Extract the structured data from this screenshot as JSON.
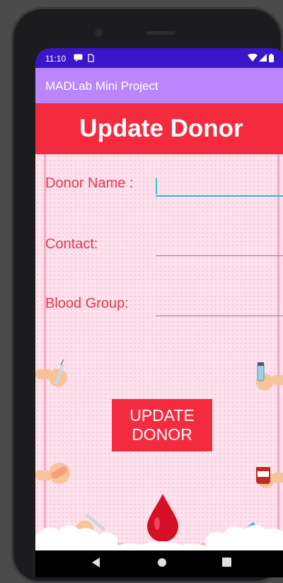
{
  "status_bar": {
    "time": "11:10",
    "icons": [
      "message-icon",
      "sim-icon",
      "wifi-icon",
      "signal-icon",
      "battery-icon"
    ]
  },
  "app_bar": {
    "title": "MADLab Mini Project"
  },
  "banner": {
    "title": "Update Donor"
  },
  "form": {
    "donor_name_label": "Donor Name :",
    "donor_name_value": "",
    "contact_label": "Contact:",
    "contact_value": "",
    "blood_group_label": "Blood Group:",
    "blood_group_value": ""
  },
  "update_button": {
    "line1": "UPDATE",
    "line2": "DONOR"
  },
  "nav_bar": {
    "back": "back-icon",
    "home": "home-icon",
    "recents": "recents-icon"
  },
  "decorations": [
    "syringe-hand-icon",
    "vial-hand-icon",
    "bandage-hand-icon",
    "pill-bottle-hand-icon",
    "thermometer-hand-icon",
    "blood-drop-icon",
    "cupped-hands-icon",
    "cloud-icon"
  ],
  "colors": {
    "status_bar": "#3a16c9",
    "app_bar": "#bb86fc",
    "accent_red": "#f42b3e",
    "label_red": "#e13a4c",
    "background_pink": "#fde1ec",
    "focus_teal": "#26c4c9"
  }
}
